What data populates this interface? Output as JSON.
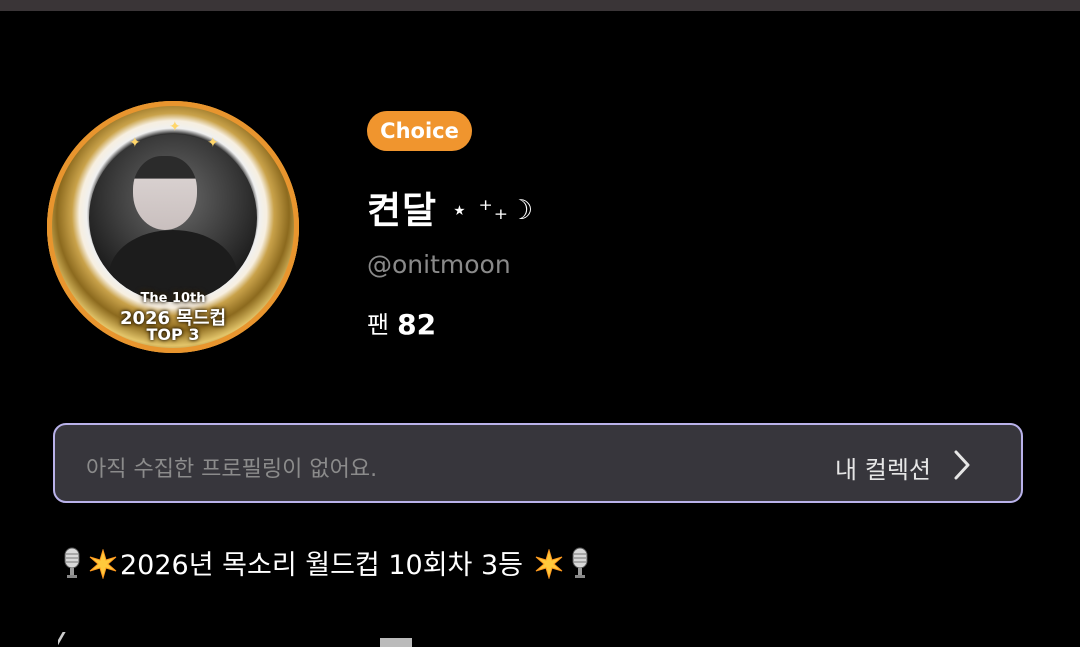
{
  "profile": {
    "badge_label": "Choice",
    "name": "켠달",
    "name_deco": "⋆ ⁺₊☽",
    "handle": "@onitmoon",
    "fans_label": "팬",
    "fans_count": "82",
    "avatar_badge": {
      "line1": "The 10th",
      "line2": "2026 목드컵",
      "line3": "TOP 3"
    }
  },
  "collection": {
    "empty_message": "아직 수집한 프로필링이 없어요.",
    "link_label": "내 컬렉션",
    "border_color": "#b9b2ea",
    "background_color": "#37363c"
  },
  "bio": {
    "line1": "2026년 목소리 월드컵 10회차 3등"
  },
  "colors": {
    "accent": "#f0952e",
    "background": "#000000"
  },
  "icons": {
    "collection_chevron": "chevron-right-icon",
    "bio_left_mic": "microphone-icon",
    "bio_left_spark": "sparkle-icon",
    "bio_right_spark": "sparkle-icon",
    "bio_right_mic": "microphone-icon"
  }
}
